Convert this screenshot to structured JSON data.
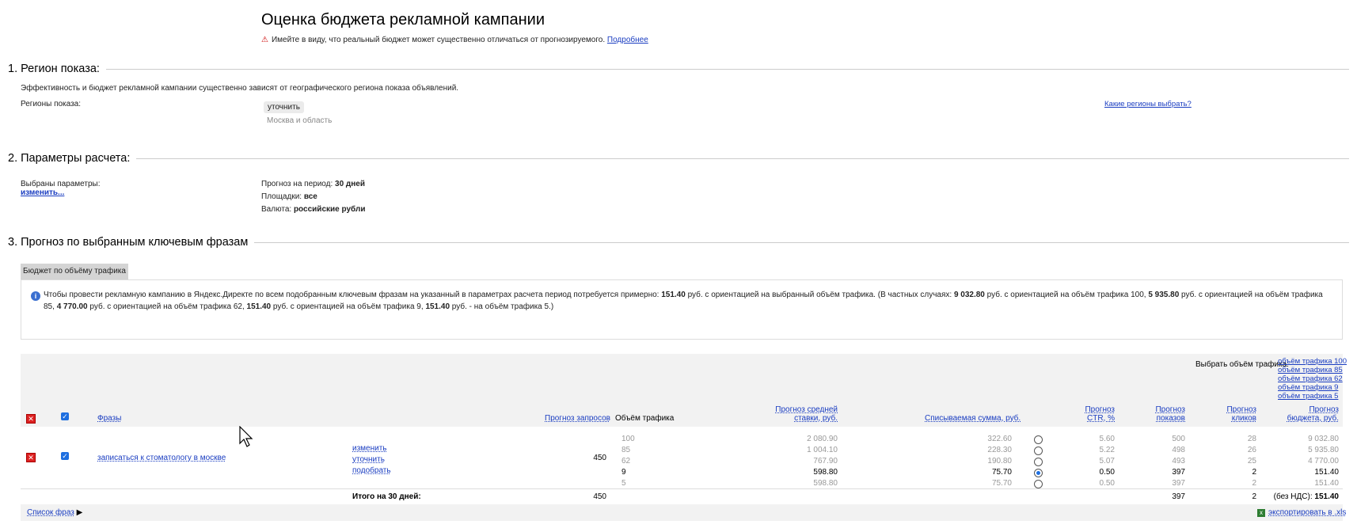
{
  "page_title": "Оценка бюджета рекламной кампании",
  "warning": {
    "text": "Имейте в виду, что реальный бюджет может существенно отличаться от прогнозируемого.",
    "link": "Подробнее"
  },
  "section1": {
    "title": "1. Регион показа:",
    "description": "Эффективность и бюджет рекламной кампании существенно зависят от географического региона показа объявлений.",
    "regions_label": "Регионы показа:",
    "clarify_button": "уточнить",
    "region_value": "Москва и область",
    "help_link": "Какие регионы выбрать?"
  },
  "section2": {
    "title": "2. Параметры расчета:",
    "selected_label": "Выбраны параметры:",
    "change_link": "изменить...",
    "period_label": "Прогноз на период:",
    "period_value": "30 дней",
    "platforms_label": "Площадки:",
    "platforms_value": "все",
    "currency_label": "Валюта:",
    "currency_value": "российские рубли"
  },
  "section3": {
    "title": "3. Прогноз по выбранным ключевым фразам",
    "tab": "Бюджет по объёму трафика",
    "info": {
      "p1": "Чтобы провести рекламную кампанию в Яндекс.Директе по всем подобранным ключевым фразам на указанный в параметрах расчета период потребуется примерно: ",
      "b1": "151.40",
      "p2": " руб. с ориентацией на выбранный объём трафика. (В частных случаях: ",
      "b2": "9 032.80",
      "p3": " руб. с ориентацией на объём трафика 100, ",
      "b3": "5 935.80",
      "p4": " руб. с ориентацией на объём трафика 85, ",
      "b4": "4 770.00",
      "p5": " руб. с ориентацией на объём трафика 62, ",
      "b5": "151.40",
      "p6": " руб. с ориентацией на объём трафика 9, ",
      "b6": "151.40",
      "p7": " руб. - на объём трафика 5.)"
    }
  },
  "table": {
    "select_traffic_label": "Выбрать объём трафика:",
    "select_traffic_links": [
      "объём трафика 100",
      "объём трафика 85",
      "объём трафика 62",
      "объём трафика 9",
      "объём трафика 5"
    ],
    "headers": {
      "phrases": "Фразы",
      "queries": "Прогноз запросов",
      "traffic": "Объём трафика",
      "avg_bid_1": "Прогноз средней",
      "avg_bid_2": "ставки, руб.",
      "charged": "Списываемая сумма, руб.",
      "ctr_1": "Прогноз",
      "ctr_2": "CTR, %",
      "shows_1": "Прогноз",
      "shows_2": "показов",
      "clicks_1": "Прогноз",
      "clicks_2": "кликов",
      "budget_1": "Прогноз",
      "budget_2": "бюджета, руб."
    },
    "row": {
      "phrase": "записаться к стоматологу в москве",
      "actions": [
        "изменить",
        "уточнить",
        "подобрать"
      ],
      "queries": "450",
      "levels": [
        {
          "traffic": "100",
          "bid": "2 080.90",
          "charged": "322.60",
          "selected": false,
          "ctr": "5.60",
          "shows": "500",
          "clicks": "28",
          "budget": "9 032.80"
        },
        {
          "traffic": "85",
          "bid": "1 004.10",
          "charged": "228.30",
          "selected": false,
          "ctr": "5.22",
          "shows": "498",
          "clicks": "26",
          "budget": "5 935.80"
        },
        {
          "traffic": "62",
          "bid": "767.90",
          "charged": "190.80",
          "selected": false,
          "ctr": "5.07",
          "shows": "493",
          "clicks": "25",
          "budget": "4 770.00"
        },
        {
          "traffic": "9",
          "bid": "598.80",
          "charged": "75.70",
          "selected": true,
          "ctr": "0.50",
          "shows": "397",
          "clicks": "2",
          "budget": "151.40"
        },
        {
          "traffic": "5",
          "bid": "598.80",
          "charged": "75.70",
          "selected": false,
          "ctr": "0.50",
          "shows": "397",
          "clicks": "2",
          "budget": "151.40"
        }
      ]
    },
    "total": {
      "label": "Итого на 30 дней:",
      "queries": "450",
      "shows": "397",
      "clicks": "2",
      "vat_label": "(без НДС):",
      "budget": "151.40"
    },
    "footer": {
      "phrase_list": "Список фраз",
      "export": "экспортировать в .xls"
    }
  }
}
